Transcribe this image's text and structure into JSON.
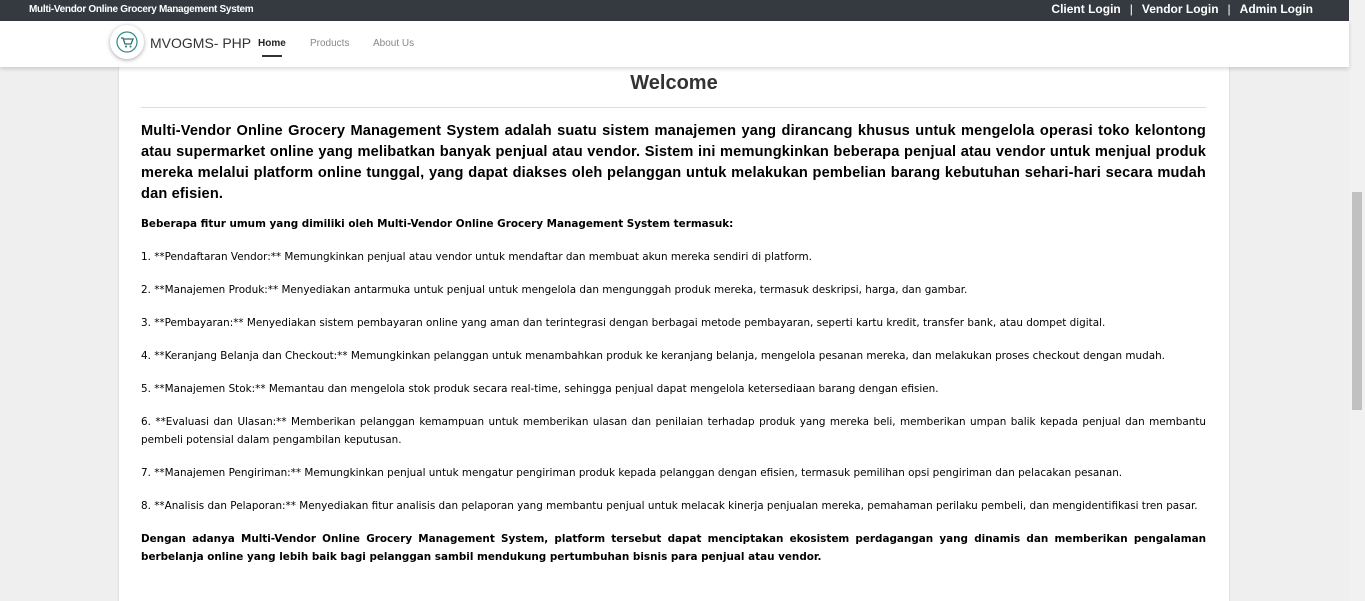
{
  "topbar": {
    "title": "Multi-Vendor Online Grocery Management System",
    "client_login": "Client Login",
    "vendor_login": "Vendor Login",
    "admin_login": "Admin Login",
    "separator": "|"
  },
  "navbar": {
    "brand": "MVOGMS- PHP",
    "logo_icon": "shopping-cart-logo-icon",
    "links": [
      "Home",
      "Products",
      "About Us"
    ],
    "active": "Home"
  },
  "main": {
    "heading": "Welcome",
    "intro": "Multi-Vendor Online Grocery Management System adalah suatu sistem manajemen yang dirancang khusus untuk mengelola operasi toko kelontong atau supermarket online yang melibatkan banyak penjual atau vendor. Sistem ini memungkinkan beberapa penjual atau vendor untuk menjual produk mereka melalui platform online tunggal, yang dapat diakses oleh pelanggan untuk melakukan pembelian barang kebutuhan sehari-hari secara mudah dan efisien.",
    "features_heading": "Beberapa fitur umum yang dimiliki oleh Multi-Vendor Online Grocery Management System termasuk:",
    "features": [
      "1. **Pendaftaran Vendor:** Memungkinkan penjual atau vendor untuk mendaftar dan membuat akun mereka sendiri di platform.",
      "2. **Manajemen Produk:** Menyediakan antarmuka untuk penjual untuk mengelola dan mengunggah produk mereka, termasuk deskripsi, harga, dan gambar.",
      "3. **Pembayaran:** Menyediakan sistem pembayaran online yang aman dan terintegrasi dengan berbagai metode pembayaran, seperti kartu kredit, transfer bank, atau dompet digital.",
      "4. **Keranjang Belanja dan Checkout:** Memungkinkan pelanggan untuk menambahkan produk ke keranjang belanja, mengelola pesanan mereka, dan melakukan proses checkout dengan mudah.",
      "5. **Manajemen Stok:** Memantau dan mengelola stok produk secara real-time, sehingga penjual dapat mengelola ketersediaan barang dengan efisien.",
      "6. **Evaluasi dan Ulasan:** Memberikan pelanggan kemampuan untuk memberikan ulasan dan penilaian terhadap produk yang mereka beli, memberikan umpan balik kepada penjual dan membantu pembeli potensial dalam pengambilan keputusan.",
      "7. **Manajemen Pengiriman:** Memungkinkan penjual untuk mengatur pengiriman produk kepada pelanggan dengan efisien, termasuk pemilihan opsi pengiriman dan pelacakan pesanan.",
      "8. **Analisis dan Pelaporan:** Menyediakan fitur analisis dan pelaporan yang membantu penjual untuk melacak kinerja penjualan mereka, pemahaman perilaku pembeli, dan mengidentifikasi tren pasar."
    ],
    "closing": "Dengan adanya Multi-Vendor Online Grocery Management System, platform tersebut dapat menciptakan ekosistem perdagangan yang dinamis dan memberikan pengalaman berbelanja online yang lebih baik bagi pelanggan sambil mendukung pertumbuhan bisnis para penjual atau vendor."
  }
}
